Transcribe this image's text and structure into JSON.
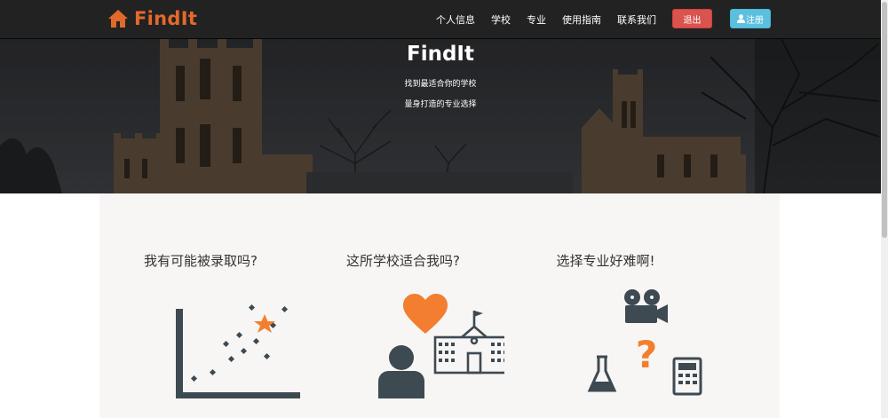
{
  "navbar": {
    "brand": "FindIt",
    "links": [
      "个人信息",
      "学校",
      "专业",
      "使用指南",
      "联系我们"
    ],
    "logout_label": "退出",
    "register_label": "注册"
  },
  "hero": {
    "title": "FindIt",
    "subtitle_1": "找到最适合你的学校",
    "subtitle_2": "量身打造的专业选择"
  },
  "features": [
    {
      "title": "我有可能被录取吗?"
    },
    {
      "title": "这所学校适合我吗?"
    },
    {
      "title": "选择专业好难啊!"
    }
  ],
  "colors": {
    "brand_orange": "#e3692b",
    "icon_orange": "#f47e2f",
    "icon_dark": "#3e4a52",
    "logout_red": "#d9534f",
    "register_blue": "#5bc0de",
    "navbar_bg": "#222222",
    "features_bg": "#f7f6f4"
  }
}
